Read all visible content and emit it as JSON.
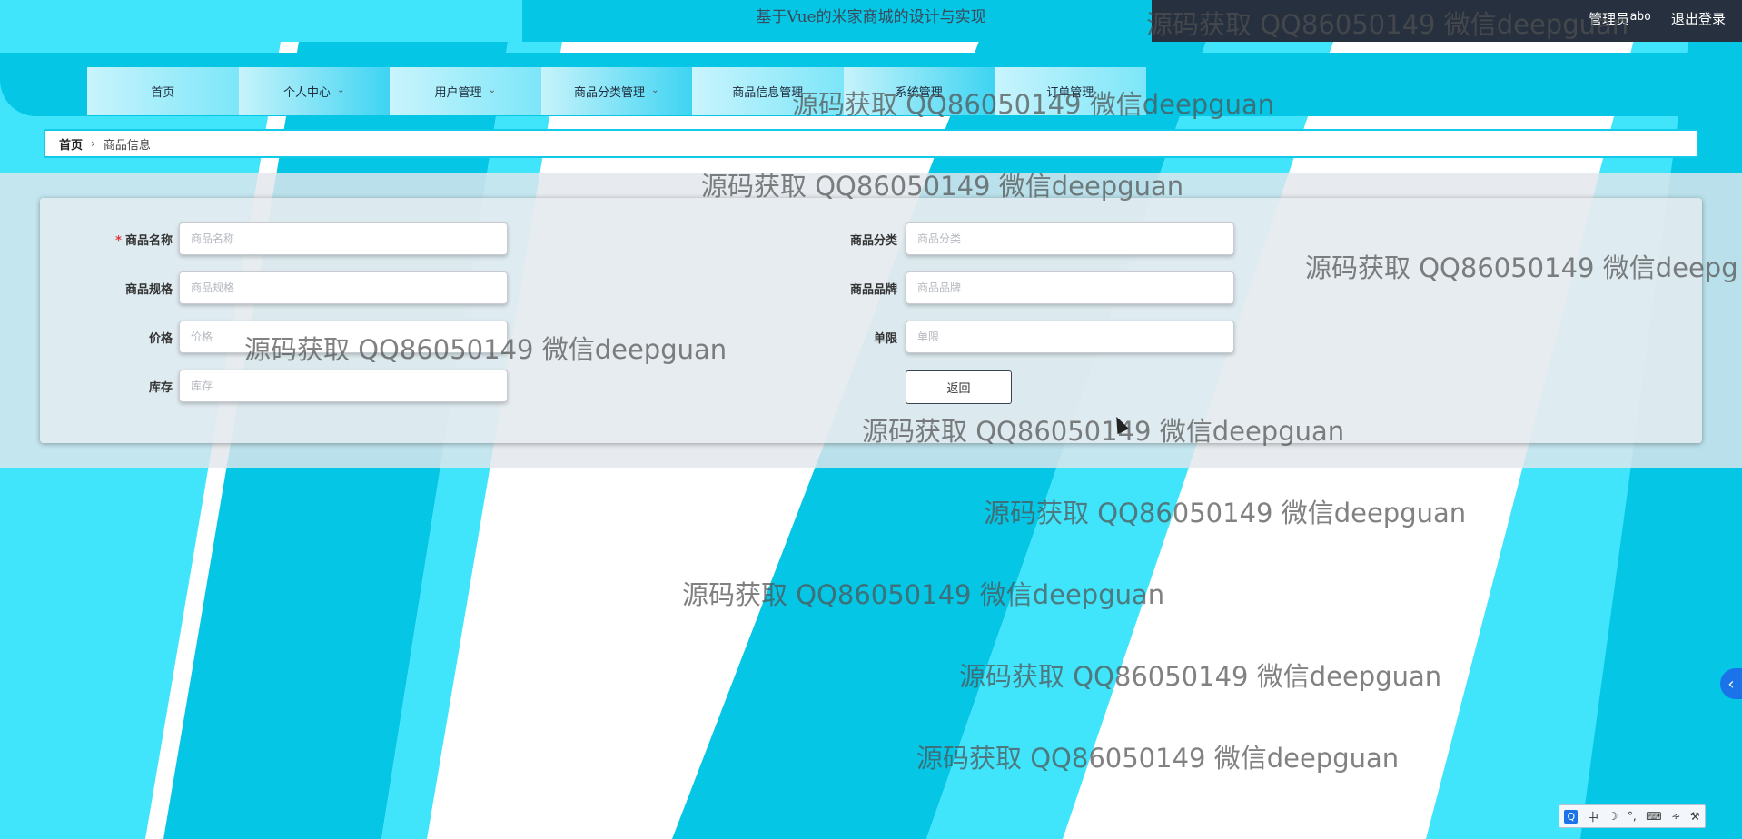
{
  "header": {
    "site_title": "基于Vue的米家商城的设计与实现",
    "user_role": "管理员",
    "user_name": "abo",
    "logout_label": "退出登录"
  },
  "nav": {
    "items": [
      {
        "label": "首页",
        "has_dropdown": false
      },
      {
        "label": "个人中心",
        "has_dropdown": true
      },
      {
        "label": "用户管理",
        "has_dropdown": true
      },
      {
        "label": "商品分类管理",
        "has_dropdown": true
      },
      {
        "label": "商品信息管理",
        "has_dropdown": false
      },
      {
        "label": "系统管理",
        "has_dropdown": false
      },
      {
        "label": "订单管理",
        "has_dropdown": false
      }
    ],
    "dropdown_icon": "chevron-down-icon"
  },
  "breadcrumb": {
    "home": "首页",
    "separator": "›",
    "current": "商品信息"
  },
  "form": {
    "required_mark": "*",
    "fields": {
      "name": {
        "label": "商品名称",
        "placeholder": "商品名称",
        "value": ""
      },
      "category": {
        "label": "商品分类",
        "placeholder": "商品分类",
        "value": ""
      },
      "spec": {
        "label": "商品规格",
        "placeholder": "商品规格",
        "value": ""
      },
      "brand": {
        "label": "商品品牌",
        "placeholder": "商品品牌",
        "value": ""
      },
      "price": {
        "label": "价格",
        "placeholder": "价格",
        "value": ""
      },
      "limit": {
        "label": "单限",
        "placeholder": "单限",
        "value": ""
      },
      "stock": {
        "label": "库存",
        "placeholder": "库存",
        "value": ""
      }
    },
    "back_label": "返回"
  },
  "watermark": {
    "text": "源码获取 QQ86050149 微信deepguan",
    "truncated_text": "源码获取 QQ86050149 微信deepg"
  },
  "side_tab": {
    "icon": "chevron-left-icon",
    "glyph": "‹"
  },
  "ime_toolbar": {
    "items": [
      "Q",
      "中",
      "☽",
      "°,",
      "⌨",
      "∻",
      "⚒"
    ]
  },
  "colors": {
    "accent": "#06c6e6",
    "accent_light": "#40e4fb",
    "user_bar": "#26303e",
    "required": "#e4393c"
  }
}
